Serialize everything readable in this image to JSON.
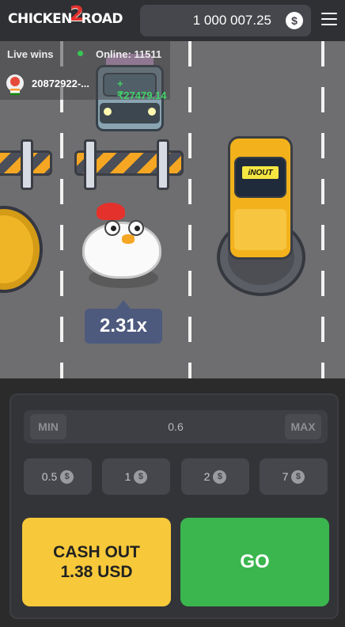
{
  "header": {
    "logo": {
      "text_before": "CHICKEN",
      "text_two": "2",
      "text_after": "ROAD"
    },
    "balance": "1 000 007.25",
    "currency_icon": "dollar-coin-icon",
    "menu_icon": "hamburger-menu-icon"
  },
  "live": {
    "label": "Live wins",
    "online": "Online: 11511",
    "win": {
      "user": "20872922-...",
      "amount": "+₹27479.14"
    }
  },
  "game": {
    "multiplier": "2.31x",
    "taxi_sign": "iNOUT"
  },
  "controls": {
    "min_label": "MIN",
    "max_label": "MAX",
    "stake": "0.6",
    "chips": [
      "0.5",
      "1",
      "2",
      "7"
    ],
    "cashout_line1": "CASH OUT",
    "cashout_line2": "1.38 USD",
    "go_label": "GO"
  },
  "colors": {
    "road": "#6e6e70",
    "cashout": "#f7c93a",
    "go": "#3bb64e",
    "multiplier_badge": "#4d5a7e",
    "win_amount": "#42d167"
  }
}
